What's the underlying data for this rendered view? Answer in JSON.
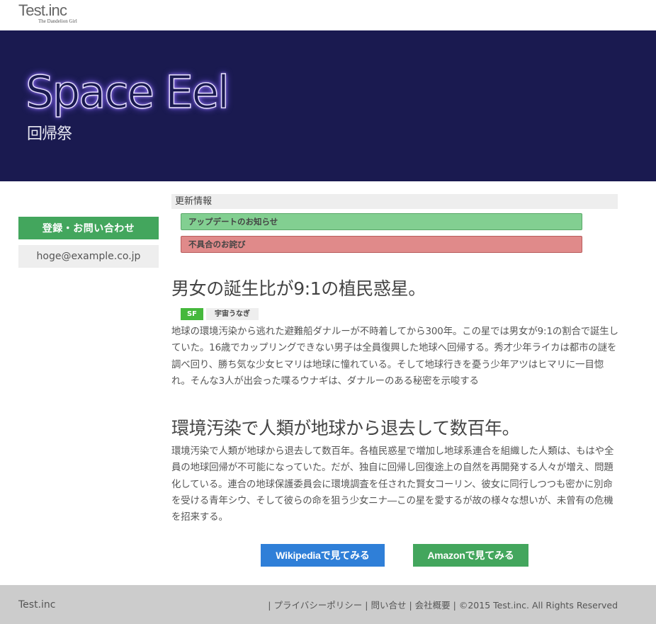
{
  "header": {
    "logo_main": "Test.inc",
    "logo_sub": "The Dandelion Girl"
  },
  "hero": {
    "title": "Space Eel",
    "subtitle": "回帰祭"
  },
  "sidebar": {
    "contact_button": "登録・お問い合わせ",
    "email": "hoge@example.co.jp"
  },
  "news": {
    "header": "更新情報",
    "items": [
      {
        "label": "アップデートのお知らせ",
        "color": "#82cf91"
      },
      {
        "label": "不具合のお詫び",
        "color": "#e08a8a"
      }
    ]
  },
  "articles": [
    {
      "title": "男女の誕生比が9:1の植民惑星。",
      "tags": [
        "SF",
        "宇宙うなぎ"
      ],
      "body": "地球の環境汚染から逃れた避難船ダナルーが不時着してから300年。この星では男女が9:1の割合で誕生していた。16歳でカップリングできない男子は全員復興した地球へ回帰する。秀才少年ライカは都市の謎を調べ回り、勝ち気な少女ヒマリは地球に憧れている。そして地球行きを憂う少年アツはヒマリに一目惚れ。そんな3人が出会った喋るウナギは、ダナルーのある秘密を示唆する"
    },
    {
      "title": "環境汚染で人類が地球から退去して数百年。",
      "body": "環境汚染で人類が地球から退去して数百年。各植民惑星で増加し地球系連合を組織した人類は、もはや全員の地球回帰が不可能になっていた。だが、独自に回帰し回復途上の自然を再開発する人々が増え、問題化している。連合の地球保護委員会に環境調査を任された賢女コーリン、彼女に同行しつつも密かに別命を受ける青年シウ、そして彼らの命を狙う少女ニナ―この星を愛するが故の様々な想いが、未曾有の危機を招来する。"
    }
  ],
  "buttons": {
    "wikipedia": "Wikipediaで見てみる",
    "amazon": "Amazonで見てみる"
  },
  "footer": {
    "brand": "Test.inc",
    "sep": "|",
    "privacy": "プライバシーポリシー",
    "contact": "問い合せ",
    "company": "会社概要",
    "copyright": "©2015 Test.inc. All Rights Reserved"
  },
  "colors": {
    "hero_bg": "#1a1a50",
    "accent_green": "#43a65d",
    "accent_blue": "#2f7fd8",
    "tag_sf": "#45b83c",
    "footer_bg": "#cccccc"
  }
}
